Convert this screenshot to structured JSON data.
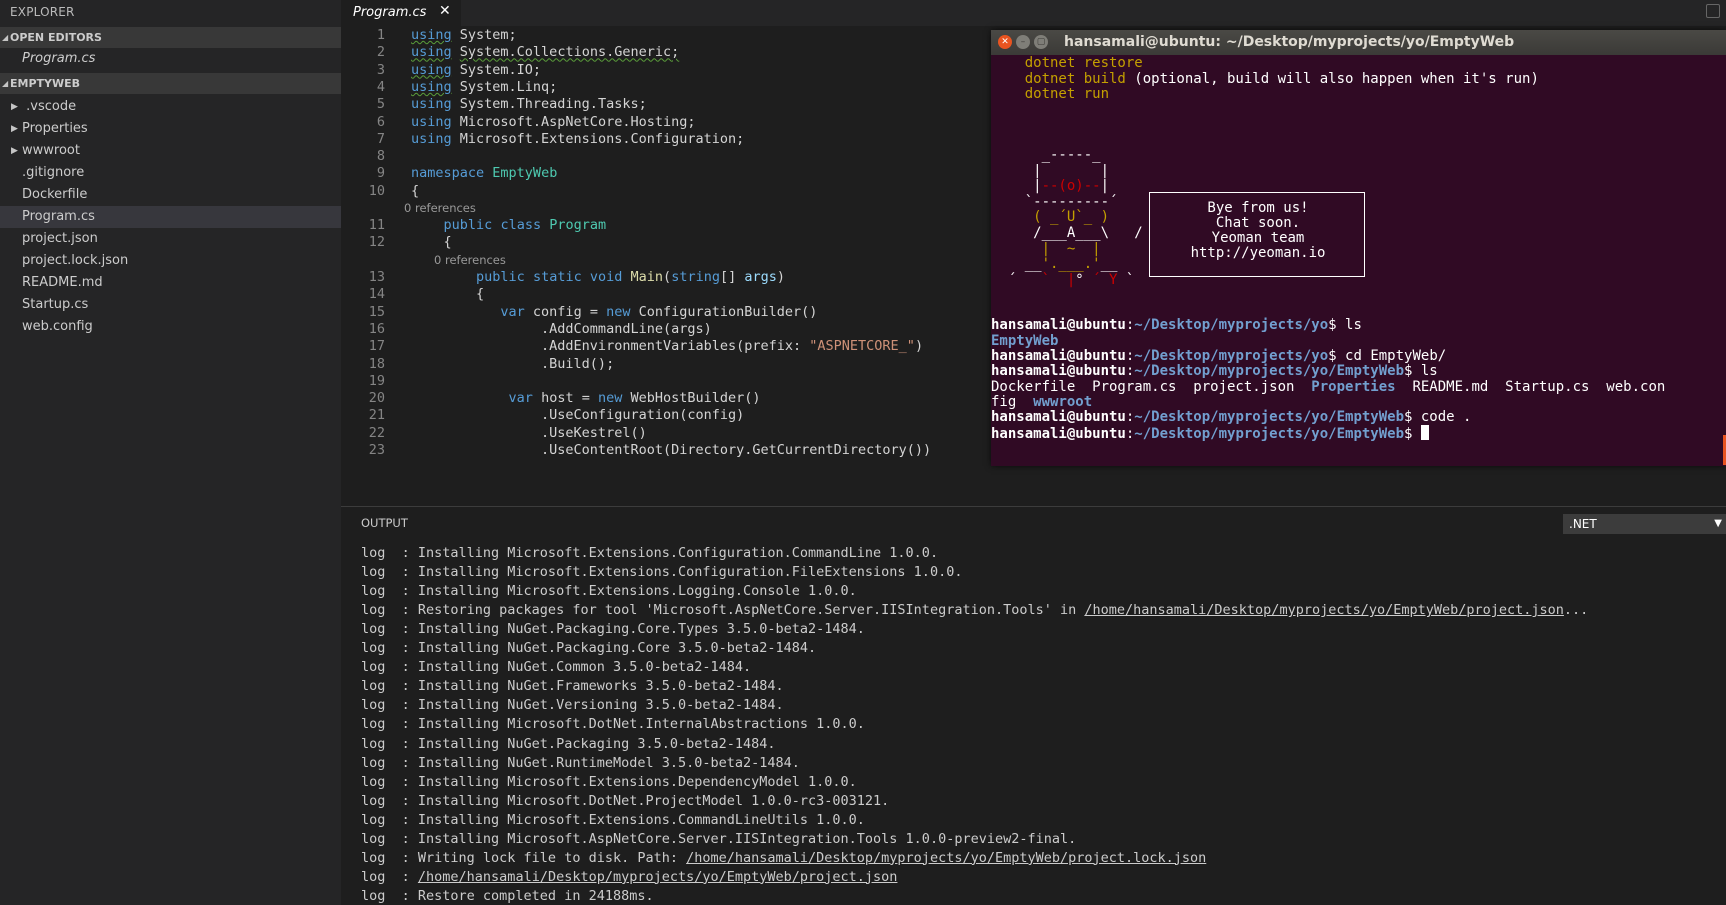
{
  "sidebar": {
    "title": "EXPLORER",
    "open_editors": {
      "header": "OPEN EDITORS",
      "files": [
        "Program.cs"
      ]
    },
    "project": {
      "header": "EMPTYWEB",
      "items": [
        {
          "label": " .vscode"
        },
        {
          "label": "Properties"
        },
        {
          "label": "wwwroot"
        },
        {
          "label": ".gitignore"
        },
        {
          "label": "Dockerfile"
        },
        {
          "label": "Program.cs"
        },
        {
          "label": "project.json"
        },
        {
          "label": "project.lock.json"
        },
        {
          "label": "README.md"
        },
        {
          "label": "Startup.cs"
        },
        {
          "label": "web.config"
        }
      ]
    }
  },
  "tabs": [
    {
      "label": "Program.cs",
      "close": "✕"
    }
  ],
  "editor": {
    "lines": [
      {
        "n": "1",
        "parts": [
          [
            "kw sq",
            "using"
          ],
          [
            "",
            " System;"
          ]
        ]
      },
      {
        "n": "2",
        "parts": [
          [
            "kw sq",
            "using"
          ],
          [
            "",
            " "
          ],
          [
            "sq",
            "System.Collections.Generic;"
          ]
        ]
      },
      {
        "n": "3",
        "parts": [
          [
            "kw sq",
            "using"
          ],
          [
            "",
            " System.IO;"
          ]
        ]
      },
      {
        "n": "4",
        "parts": [
          [
            "kw sq",
            "using"
          ],
          [
            "",
            " System.Linq;"
          ]
        ]
      },
      {
        "n": "5",
        "parts": [
          [
            "kw",
            "using"
          ],
          [
            "",
            " System.Threading.Tasks;"
          ]
        ]
      },
      {
        "n": "6",
        "parts": [
          [
            "kw",
            "using"
          ],
          [
            "",
            " Microsoft.AspNetCore.Hosting;"
          ]
        ]
      },
      {
        "n": "7",
        "parts": [
          [
            "kw",
            "using"
          ],
          [
            "",
            " Microsoft.Extensions.Configuration;"
          ]
        ]
      },
      {
        "n": "8",
        "parts": []
      },
      {
        "n": "9",
        "parts": [
          [
            "kw",
            "namespace"
          ],
          [
            "",
            " "
          ],
          [
            "ty",
            "EmptyWeb"
          ]
        ]
      },
      {
        "n": "10",
        "parts": [
          [
            "",
            "{"
          ]
        ]
      },
      {
        "n": "11",
        "parts": [
          [
            "",
            "    "
          ],
          [
            "kw",
            "public"
          ],
          [
            "",
            " "
          ],
          [
            "kw",
            "class"
          ],
          [
            "",
            " "
          ],
          [
            "ty",
            "Program"
          ]
        ]
      },
      {
        "n": "12",
        "parts": [
          [
            "",
            "    {"
          ]
        ]
      },
      {
        "n": "13",
        "parts": [
          [
            "",
            "        "
          ],
          [
            "kw",
            "public"
          ],
          [
            "",
            " "
          ],
          [
            "kw",
            "static"
          ],
          [
            "",
            " "
          ],
          [
            "kw",
            "void"
          ],
          [
            "",
            " "
          ],
          [
            "fn",
            "Main"
          ],
          [
            "",
            "("
          ],
          [
            "kw",
            "string"
          ],
          [
            "",
            "[] "
          ],
          [
            "par",
            "args"
          ],
          [
            "",
            ")"
          ]
        ]
      },
      {
        "n": "14",
        "parts": [
          [
            "",
            "        {"
          ]
        ]
      },
      {
        "n": "15",
        "parts": [
          [
            "",
            "           "
          ],
          [
            "kw",
            "var"
          ],
          [
            "",
            " config = "
          ],
          [
            "kw",
            "new"
          ],
          [
            "",
            " ConfigurationBuilder()"
          ]
        ]
      },
      {
        "n": "16",
        "parts": [
          [
            "",
            "                .AddCommandLine(args)"
          ]
        ]
      },
      {
        "n": "17",
        "parts": [
          [
            "",
            "                .AddEnvironmentVariables(prefix: "
          ],
          [
            "str",
            "\"ASPNETCORE_\""
          ],
          [
            "",
            ")"
          ]
        ]
      },
      {
        "n": "18",
        "parts": [
          [
            "",
            "                .Build();"
          ]
        ]
      },
      {
        "n": "19",
        "parts": []
      },
      {
        "n": "20",
        "parts": [
          [
            "",
            "            "
          ],
          [
            "kw",
            "var"
          ],
          [
            "",
            " host = "
          ],
          [
            "kw",
            "new"
          ],
          [
            "",
            " WebHostBuilder()"
          ]
        ]
      },
      {
        "n": "21",
        "parts": [
          [
            "",
            "                .UseConfiguration(config)"
          ]
        ]
      },
      {
        "n": "22",
        "parts": [
          [
            "",
            "                .UseKestrel()"
          ]
        ]
      },
      {
        "n": "23",
        "parts": [
          [
            "",
            "                .UseContentRoot(Directory.GetCurrentDirectory())"
          ]
        ]
      }
    ],
    "references": [
      "0 references",
      "0 references"
    ]
  },
  "panel": {
    "title": "OUTPUT",
    "channel": ".NET",
    "lines": [
      [
        [
          "",
          "log  : Installing Microsoft.Extensions.Configuration.CommandLine 1.0.0."
        ]
      ],
      [
        [
          "",
          "log  : Installing Microsoft.Extensions.Configuration.FileExtensions 1.0.0."
        ]
      ],
      [
        [
          "",
          "log  : Installing Microsoft.Extensions.Logging.Console 1.0.0."
        ]
      ],
      [
        [
          "",
          "log  : Restoring packages for tool 'Microsoft.AspNetCore.Server.IISIntegration.Tools' in "
        ],
        [
          "u",
          "/home/hansamali/Desktop/myprojects/yo/EmptyWeb/project.json"
        ],
        [
          "",
          "..."
        ]
      ],
      [
        [
          "",
          "log  : Installing NuGet.Packaging.Core.Types 3.5.0-beta2-1484."
        ]
      ],
      [
        [
          "",
          "log  : Installing NuGet.Packaging.Core 3.5.0-beta2-1484."
        ]
      ],
      [
        [
          "",
          "log  : Installing NuGet.Common 3.5.0-beta2-1484."
        ]
      ],
      [
        [
          "",
          "log  : Installing NuGet.Frameworks 3.5.0-beta2-1484."
        ]
      ],
      [
        [
          "",
          "log  : Installing NuGet.Versioning 3.5.0-beta2-1484."
        ]
      ],
      [
        [
          "",
          "log  : Installing Microsoft.DotNet.InternalAbstractions 1.0.0."
        ]
      ],
      [
        [
          "",
          "log  : Installing NuGet.Packaging 3.5.0-beta2-1484."
        ]
      ],
      [
        [
          "",
          "log  : Installing NuGet.RuntimeModel 3.5.0-beta2-1484."
        ]
      ],
      [
        [
          "",
          "log  : Installing Microsoft.Extensions.DependencyModel 1.0.0."
        ]
      ],
      [
        [
          "",
          "log  : Installing Microsoft.DotNet.ProjectModel 1.0.0-rc3-003121."
        ]
      ],
      [
        [
          "",
          "log  : Installing Microsoft.Extensions.CommandLineUtils 1.0.0."
        ]
      ],
      [
        [
          "",
          "log  : Installing Microsoft.AspNetCore.Server.IISIntegration.Tools 1.0.0-preview2-final."
        ]
      ],
      [
        [
          "",
          "log  : Writing lock file to disk. Path: "
        ],
        [
          "u",
          "/home/hansamali/Desktop/myprojects/yo/EmptyWeb/project.lock.json"
        ]
      ],
      [
        [
          "",
          "log  : "
        ],
        [
          "u",
          "/home/hansamali/Desktop/myprojects/yo/EmptyWeb/project.json"
        ]
      ],
      [
        [
          "",
          "log  : Restore completed in 24188ms."
        ]
      ]
    ]
  },
  "terminal": {
    "title": "hansamali@ubuntu: ~/Desktop/myprojects/yo/EmptyWeb",
    "buttons": [
      "✕",
      "–",
      "▢"
    ],
    "lines": [
      [
        [
          "yl",
          "    dotnet restore"
        ]
      ],
      [
        [
          "yl",
          "    dotnet build"
        ],
        [
          "",
          " (optional, build will also happen when it's run)"
        ]
      ],
      [
        [
          "yl",
          "    dotnet run"
        ]
      ],
      [],
      [],
      [],
      [
        [
          "",
          "      _-----_"
        ]
      ],
      [
        [
          "",
          "     |       |"
        ]
      ],
      [
        [
          "",
          "     |"
        ],
        [
          "rd",
          "--(o)--"
        ],
        [
          "",
          "|"
        ]
      ],
      [
        [
          "",
          "    `---------´"
        ]
      ],
      [
        [
          "",
          "     "
        ],
        [
          "yl",
          "( _´U`_ )"
        ]
      ],
      [
        [
          "",
          "     /___A___\\   /"
        ]
      ],
      [
        [
          "",
          "      "
        ],
        [
          "yl",
          "|  ~  |"
        ]
      ],
      [
        [
          "",
          "    __"
        ],
        [
          "yl",
          "'.___.'"
        ],
        [
          "",
          "__"
        ]
      ],
      [
        [
          "",
          "  ´   "
        ],
        [
          "rd",
          "`  |"
        ],
        [
          "",
          "° "
        ],
        [
          "rd",
          "´ Y"
        ],
        [
          "",
          " `"
        ]
      ],
      [],
      [
        [
          "pg",
          "hansamali@ubuntu"
        ],
        [
          "",
          ":"
        ],
        [
          "pp",
          "~/Desktop/myprojects/yo"
        ],
        [
          "",
          "$ ls"
        ]
      ],
      [
        [
          "dr",
          "EmptyWeb"
        ]
      ],
      [
        [
          "pg",
          "hansamali@ubuntu"
        ],
        [
          "",
          ":"
        ],
        [
          "pp",
          "~/Desktop/myprojects/yo"
        ],
        [
          "",
          "$ cd EmptyWeb/"
        ]
      ],
      [
        [
          "pg",
          "hansamali@ubuntu"
        ],
        [
          "",
          ":"
        ],
        [
          "pp",
          "~/Desktop/myprojects/yo/EmptyWeb"
        ],
        [
          "",
          "$ ls"
        ]
      ],
      [
        [
          "",
          "Dockerfile  Program.cs  project.json  "
        ],
        [
          "dr",
          "Properties"
        ],
        [
          "",
          "  README.md  Startup.cs  web.con"
        ]
      ],
      [
        [
          "",
          "fig  "
        ],
        [
          "dr",
          "wwwroot"
        ]
      ],
      [
        [
          "pg",
          "hansamali@ubuntu"
        ],
        [
          "",
          ":"
        ],
        [
          "pp",
          "~/Desktop/myprojects/yo/EmptyWeb"
        ],
        [
          "",
          "$ code ."
        ]
      ],
      [
        [
          "pg",
          "hansamali@ubuntu"
        ],
        [
          "",
          ":"
        ],
        [
          "pp",
          "~/Desktop/myprojects/yo/EmptyWeb"
        ],
        [
          "",
          "$ "
        ]
      ]
    ],
    "bubble": [
      "Bye from us!",
      "Chat soon.",
      "Yeoman team",
      "http://yeoman.io"
    ]
  }
}
